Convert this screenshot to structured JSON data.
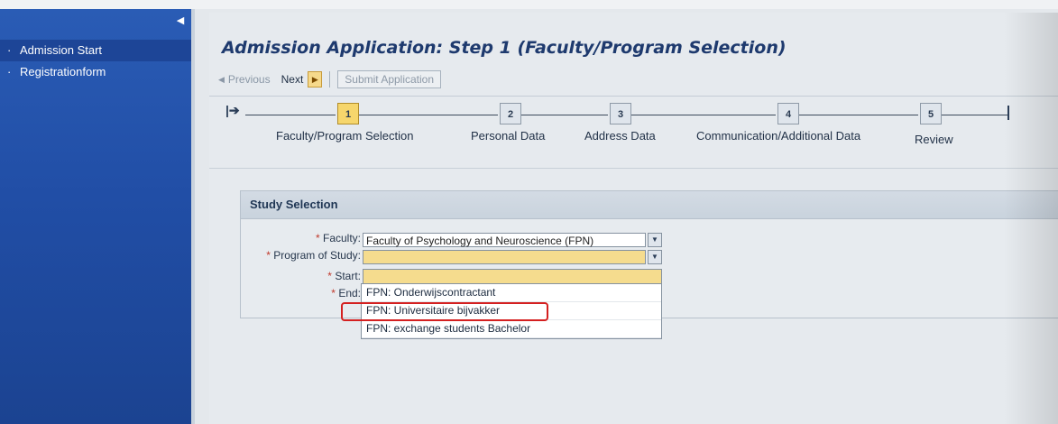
{
  "sidebar": {
    "collapse_glyph": "◀",
    "items": [
      {
        "label": "Admission Start"
      },
      {
        "label": "Registrationform"
      }
    ]
  },
  "page_title": "Admission Application: Step 1  (Faculty/Program Selection)",
  "toolbar": {
    "previous_label": "Previous",
    "next_label": "Next",
    "submit_label": "Submit Application"
  },
  "roadmap": {
    "steps": [
      {
        "number": "1",
        "label": "Faculty/Program Selection",
        "active": true
      },
      {
        "number": "2",
        "label": "Personal Data",
        "active": false
      },
      {
        "number": "3",
        "label": "Address Data",
        "active": false
      },
      {
        "number": "4",
        "label": "Communication/Additional Data",
        "active": false
      },
      {
        "number": "5",
        "label": "Review",
        "active": false
      }
    ]
  },
  "study_selection": {
    "title": "Study Selection",
    "fields": {
      "faculty": {
        "label": "Faculty:",
        "value": "Faculty of Psychology and Neuroscience (FPN)"
      },
      "program": {
        "label": "Program of Study:",
        "value": ""
      },
      "start": {
        "label": "Start:"
      },
      "end": {
        "label": "End:"
      }
    },
    "required_marker": "*",
    "program_options": [
      "FPN: Onderwijscontractant",
      "FPN: Universitaire bijvakker",
      "FPN: exchange students Bachelor"
    ],
    "highlighted_option_index": 1
  },
  "colors": {
    "sidebar_blue": "#2a5cb5",
    "active_step_yellow": "#f6d66c",
    "highlight_red": "#d42020",
    "title_blue": "#1e3a6e"
  }
}
